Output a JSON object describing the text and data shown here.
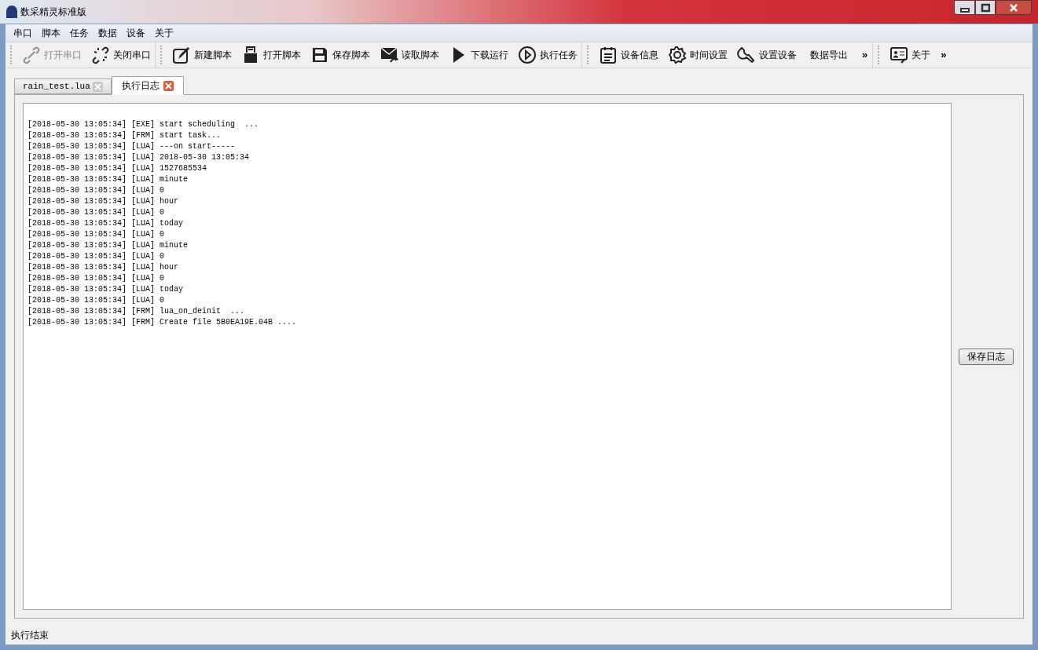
{
  "window": {
    "title": "数采精灵标准版"
  },
  "menu": [
    "串口",
    "脚本",
    "任务",
    "数据",
    "设备",
    "关于"
  ],
  "toolbar": {
    "groups": [
      {
        "items": [
          {
            "label": "打开串口",
            "disabled": true
          },
          {
            "label": "关闭串口",
            "disabled": false
          }
        ]
      },
      {
        "items": [
          {
            "label": "新建脚本",
            "disabled": false
          },
          {
            "label": "打开脚本",
            "disabled": false
          },
          {
            "label": "保存脚本",
            "disabled": false
          },
          {
            "label": "读取脚本",
            "disabled": false
          },
          {
            "label": "下载运行",
            "disabled": false
          },
          {
            "label": "执行任务",
            "disabled": false
          }
        ]
      },
      {
        "items": [
          {
            "label": "设备信息",
            "disabled": false
          },
          {
            "label": "时间设置",
            "disabled": false
          },
          {
            "label": "设置设备",
            "disabled": false
          },
          {
            "label": "数据导出",
            "disabled": false
          }
        ],
        "overflow": "»"
      },
      {
        "items": [
          {
            "label": "关于",
            "disabled": false
          }
        ],
        "overflow": "»"
      }
    ]
  },
  "tabs": [
    {
      "label": "rain_test.lua",
      "selected": false
    },
    {
      "label": "执行日志",
      "selected": true
    }
  ],
  "log": [
    "[2018-05-30 13:05:34] [EXE] start scheduling  ...",
    "[2018-05-30 13:05:34] [FRM] start task...",
    "[2018-05-30 13:05:34] [LUA] ---on start-----",
    "[2018-05-30 13:05:34] [LUA] 2018-05-30 13:05:34",
    "[2018-05-30 13:05:34] [LUA] 1527685534",
    "[2018-05-30 13:05:34] [LUA] minute",
    "[2018-05-30 13:05:34] [LUA] 0",
    "[2018-05-30 13:05:34] [LUA] hour",
    "[2018-05-30 13:05:34] [LUA] 0",
    "[2018-05-30 13:05:34] [LUA] today",
    "[2018-05-30 13:05:34] [LUA] 0",
    "[2018-05-30 13:05:34] [LUA] minute",
    "[2018-05-30 13:05:34] [LUA] 0",
    "[2018-05-30 13:05:34] [LUA] hour",
    "[2018-05-30 13:05:34] [LUA] 0",
    "[2018-05-30 13:05:34] [LUA] today",
    "[2018-05-30 13:05:34] [LUA] 0",
    "[2018-05-30 13:05:34] [FRM] lua_on_deinit  ...",
    "[2018-05-30 13:05:34] [FRM] Create file 5B0EA19E.04B ...."
  ],
  "save_log_button": "保存日志",
  "status_bar": "执行结束"
}
